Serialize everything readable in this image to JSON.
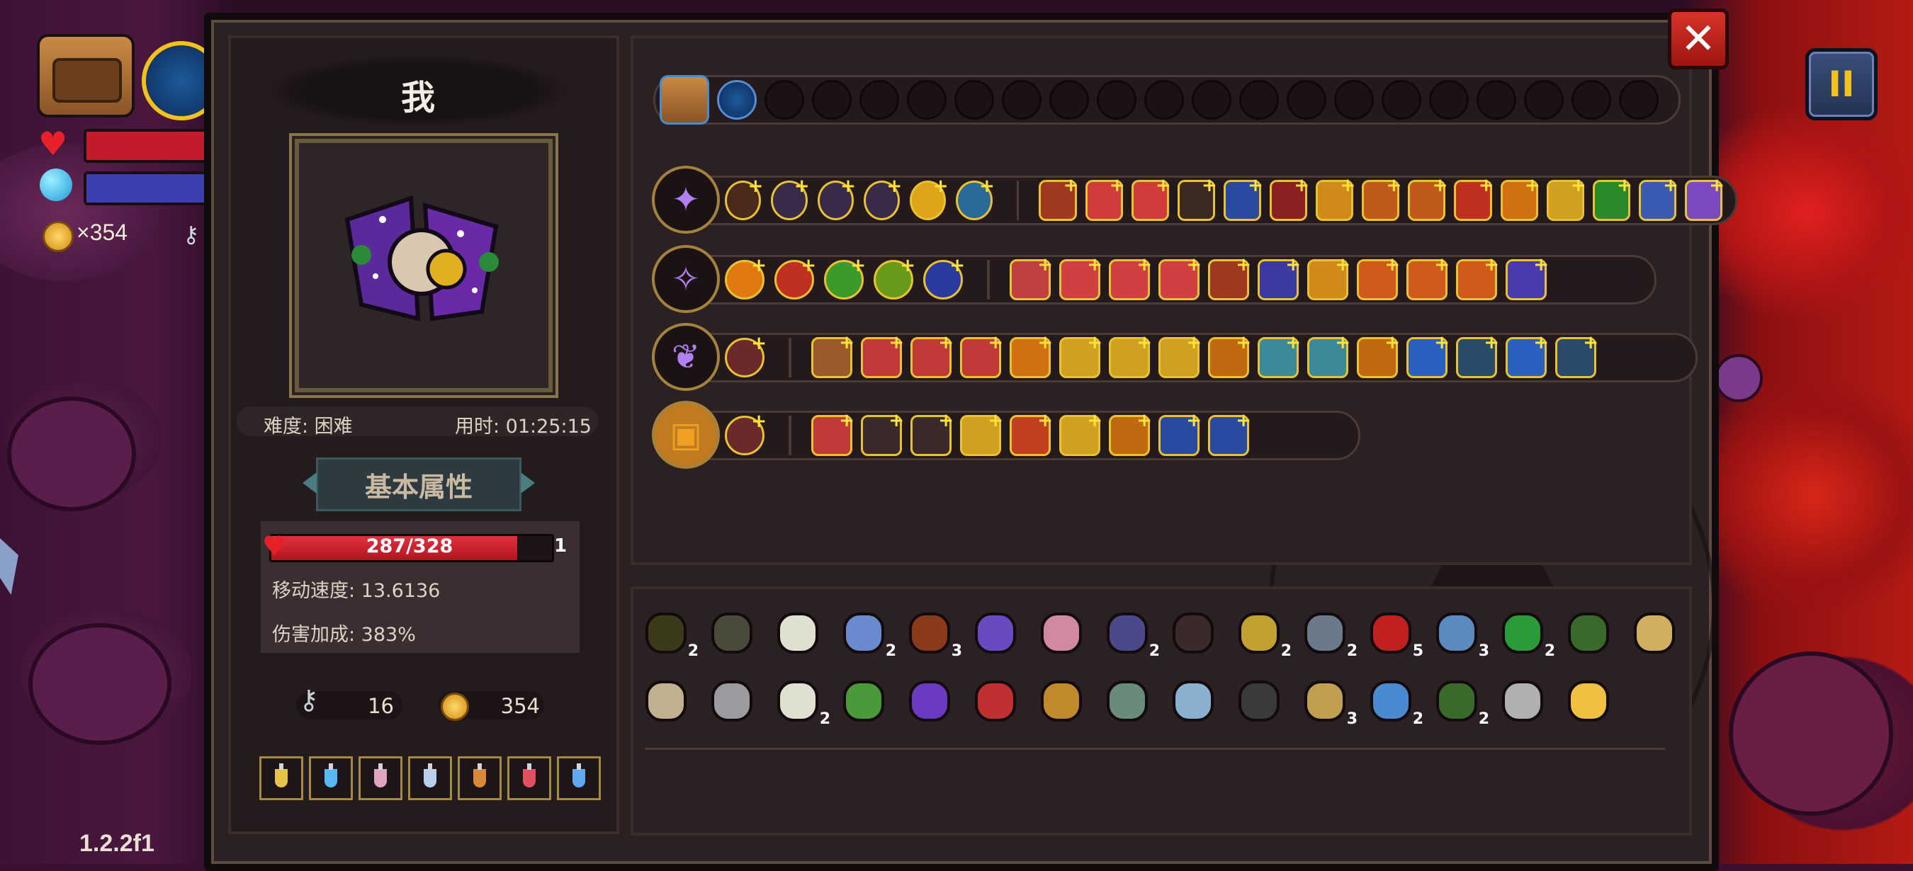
{
  "hud": {
    "gold_text": "×354",
    "version": "1.2.2f1",
    "pause_label": "II"
  },
  "panel": {
    "close_label": "✕"
  },
  "character": {
    "name": "我",
    "difficulty": "难度: 困难",
    "time_used": "用时: 01:25:15",
    "attributes_tab": "基本属性",
    "hp_text": "287/328",
    "hp_fraction": 0.875,
    "hp_level": "1",
    "move_speed": "移动速度: 13.6136",
    "damage_bonus": "伤害加成: 383%",
    "keys": "16",
    "gold": "354"
  },
  "potions": [
    {
      "color": "#e8c34a"
    },
    {
      "color": "#58b8f0"
    },
    {
      "color": "#e0a4c0"
    },
    {
      "color": "#b8d0e8"
    },
    {
      "color": "#d88a3a"
    },
    {
      "color": "#e05060"
    },
    {
      "color": "#60a8f0"
    }
  ],
  "quick_slots": {
    "filled": [
      {
        "icon": "chest-icon"
      },
      {
        "icon": "vortex-icon"
      }
    ],
    "empty_count": 19
  },
  "wands": [
    {
      "icon": "dark-staff-icon",
      "left_spells": [
        "#4a2a1a",
        "#3a2a4a",
        "#3a2a4a",
        "#3a2a4a",
        "#e0a41a",
        "#2a6a9a"
      ],
      "right_spells": [
        "#a03820",
        "#d03c3c",
        "#d03c3c",
        "#3a2a22",
        "#2a4aa0",
        "#8a2020",
        "#d08a1a",
        "#c05a1a",
        "#c05a1a",
        "#c03020",
        "#d07010",
        "#d0a020",
        "#2a8a2a",
        "#3a5ab0",
        "#7a4ac0"
      ]
    },
    {
      "icon": "purple-staff-icon",
      "left_spells": [
        "#e07a10",
        "#c03020",
        "#3a9a2a",
        "#6a9a1a",
        "#2a3aa0"
      ],
      "right_spells": [
        "#c04040",
        "#d04040",
        "#d04040",
        "#d04040",
        "#a03820",
        "#3a3aa0",
        "#d08a1a",
        "#d05a1a",
        "#d05a1a",
        "#d05a1a",
        "#4a3ab0"
      ]
    },
    {
      "icon": "feather-staff-icon",
      "left_spells": [
        "#6a2a2a"
      ],
      "right_spells": [
        "#9a5a2a",
        "#c03a3a",
        "#c03a3a",
        "#c03a3a",
        "#d07010",
        "#d0a020",
        "#d0a020",
        "#d0a020",
        "#c06a10",
        "#3a8a9a",
        "#3a8a9a",
        "#c06a10",
        "#2a60c0",
        "#2a4a6a",
        "#2a60c0",
        "#2a4a6a"
      ]
    },
    {
      "icon": "spellbook-icon",
      "left_spells": [
        "#6a2a2a"
      ],
      "right_spells": [
        "#c03a3a",
        "#3a2a2a",
        "#3a2a2a",
        "#d0a020",
        "#c04020",
        "#d0a020",
        "#c06a10",
        "#2a4aa0",
        "#2a4aa0"
      ]
    }
  ],
  "items_row1": [
    {
      "icon": "plague-mask-icon",
      "count": "2",
      "color": "#3a3a1a"
    },
    {
      "icon": "bracelet-icon",
      "count": "",
      "color": "#4a4a3a"
    },
    {
      "icon": "ribcage-icon",
      "count": "",
      "color": "#e0e0d0"
    },
    {
      "icon": "mirror-icon",
      "count": "2",
      "color": "#6a8ad0"
    },
    {
      "icon": "crate-icon",
      "count": "3",
      "color": "#8a3a1a"
    },
    {
      "icon": "crystal-icon",
      "count": "",
      "color": "#6a4ac0"
    },
    {
      "icon": "brain-icon",
      "count": "",
      "color": "#d08aa0"
    },
    {
      "icon": "gauntlet-icon",
      "count": "2",
      "color": "#4a4a8a"
    },
    {
      "icon": "bat-icon",
      "count": "",
      "color": "#3a2a2a"
    },
    {
      "icon": "dice-icon",
      "count": "2",
      "color": "#c0a030"
    },
    {
      "icon": "rock-icon",
      "count": "2",
      "color": "#6a7a8a"
    },
    {
      "icon": "demon-head-icon",
      "count": "5",
      "color": "#c02020"
    },
    {
      "icon": "magnifier-icon",
      "count": "3",
      "color": "#5a8ac0"
    },
    {
      "icon": "clover-icon",
      "count": "2",
      "color": "#2a9a3a"
    },
    {
      "icon": "boot-icon",
      "count": "",
      "color": "#3a6a2a"
    },
    {
      "icon": "bread-icon",
      "count": "",
      "color": "#d0b060"
    }
  ],
  "items_row2": [
    {
      "icon": "glasses-icon",
      "count": "",
      "color": "#c0b090"
    },
    {
      "icon": "crown-icon",
      "count": "",
      "color": "#9a9aa0"
    },
    {
      "icon": "fangs-icon",
      "count": "2",
      "color": "#e0e0d0"
    },
    {
      "icon": "leaf-icon",
      "count": "",
      "color": "#4a9a3a"
    },
    {
      "icon": "wizard-hat-icon",
      "count": "",
      "color": "#6a3ac0"
    },
    {
      "icon": "sausage-icon",
      "count": "",
      "color": "#c03030"
    },
    {
      "icon": "pickaxe-icon",
      "count": "",
      "color": "#c08a2a"
    },
    {
      "icon": "compass-icon",
      "count": "",
      "color": "#6a8a7a"
    },
    {
      "icon": "wrench-icon",
      "count": "",
      "color": "#8ab0d0"
    },
    {
      "icon": "worm-icon",
      "count": "",
      "color": "#3a3a3a"
    },
    {
      "icon": "sword-icon",
      "count": "3",
      "color": "#c0a050"
    },
    {
      "icon": "bubble-ring-icon",
      "count": "2",
      "color": "#4a8ad0"
    },
    {
      "icon": "green-cloth-icon",
      "count": "2",
      "color": "#3a6a2a"
    },
    {
      "icon": "key-icon",
      "count": "",
      "color": "#b0b0b0"
    },
    {
      "icon": "candy-corn-icon",
      "count": "",
      "color": "#f0c040"
    }
  ]
}
